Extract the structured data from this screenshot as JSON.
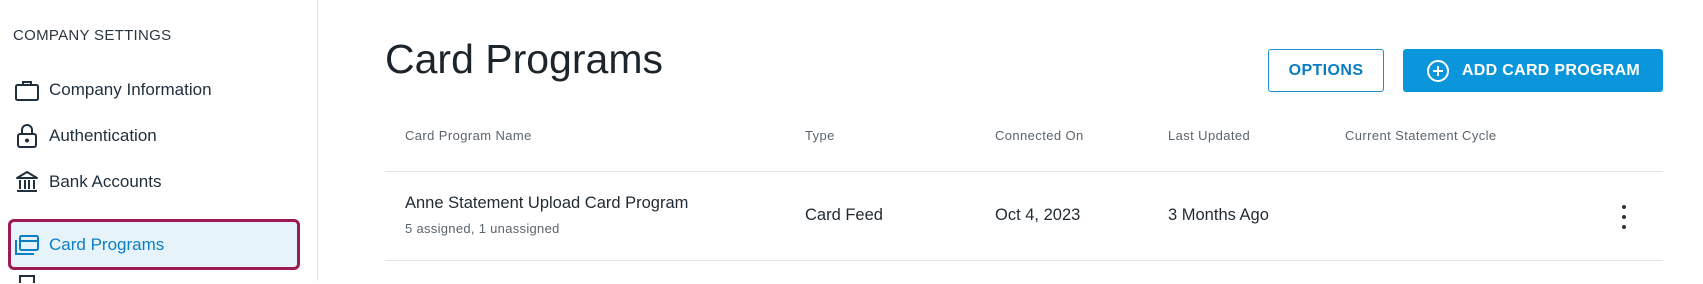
{
  "sidebar": {
    "heading": "COMPANY SETTINGS",
    "items": [
      {
        "label": "Company Information",
        "icon": "briefcase-icon"
      },
      {
        "label": "Authentication",
        "icon": "lock-icon"
      },
      {
        "label": "Bank Accounts",
        "icon": "bank-icon"
      },
      {
        "label": "Card Programs",
        "icon": "card-programs-icon",
        "active": true
      }
    ]
  },
  "main": {
    "title": "Card Programs",
    "options_label": "OPTIONS",
    "add_label": "ADD CARD PROGRAM",
    "columns": [
      "Card Program Name",
      "Type",
      "Connected On",
      "Last Updated",
      "Current Statement Cycle"
    ],
    "rows": [
      {
        "name": "Anne Statement Upload Card Program",
        "assignment": "5 assigned, 1 unassigned",
        "type": "Card Feed",
        "connected_on": "Oct 4, 2023",
        "last_updated": "3 Months Ago",
        "statement_cycle": ""
      }
    ]
  },
  "colors": {
    "accent": "#0b96dc",
    "active_bg": "#e6f3fa",
    "focus_outline": "#9c1b55"
  }
}
